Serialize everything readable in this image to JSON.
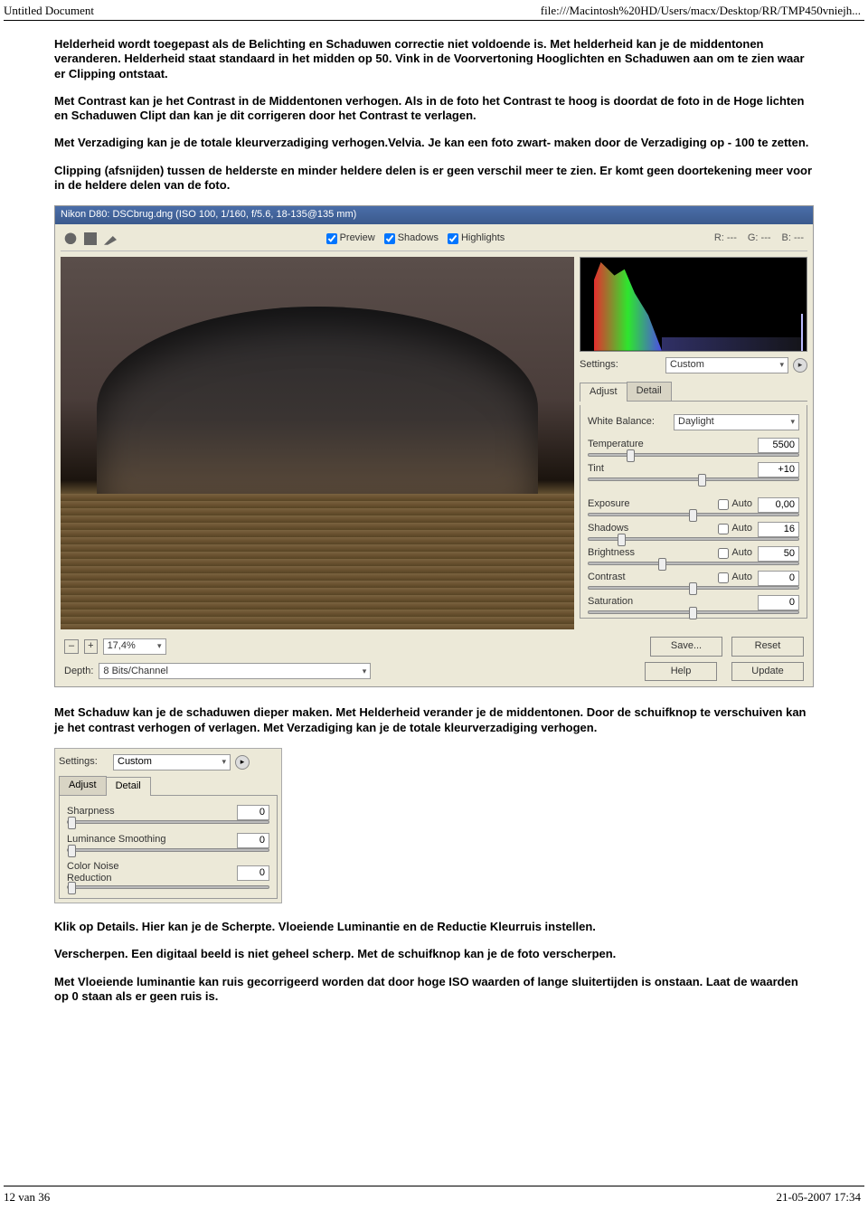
{
  "header": {
    "left": "Untitled Document",
    "right": "file:///Macintosh%20HD/Users/macx/Desktop/RR/TMP450vniejh..."
  },
  "paragraphs": {
    "p1": "Helderheid wordt toegepast als de Belichting en Schaduwen correctie niet voldoende is. Met helderheid kan je de middentonen veranderen. Helderheid staat standaard in het midden op 50. Vink in de Voorvertoning Hooglichten en Schaduwen aan om te zien waar er Clipping ontstaat.",
    "p2": "Met Contrast kan je het Contrast in de Middentonen verhogen. Als in de foto het Contrast te hoog is doordat de foto in de Hoge lichten en Schaduwen Clipt dan kan je dit corrigeren door het Contrast te verlagen.",
    "p3": "Met Verzadiging kan je de totale kleurverzadiging verhogen.Velvia. Je kan een foto zwart- maken door de Verzadiging op - 100 te zetten.",
    "p4": "Clipping (afsnijden) tussen de helderste en minder heldere delen is er geen verschil meer te zien. Er komt geen doortekening meer voor in de heldere delen van de foto.",
    "p5": "Met Schaduw kan je de schaduwen dieper maken. Met Helderheid verander je de middentonen. Door de schuifknop te verschuiven kan je het contrast verhogen of verlagen. Met Verzadiging kan je de totale kleurverzadiging verhogen.",
    "p6": "Klik op Details. Hier kan je de Scherpte. Vloeiende Luminantie en de Reductie Kleurruis instellen.",
    "p7": "Verscherpen. Een digitaal beeld is niet geheel scherp. Met de schuifknop kan je de foto verscherpen.",
    "p8": "Met Vloeiende luminantie kan ruis gecorrigeerd worden dat door hoge ISO waarden of lange sluitertijden is onstaan. Laat de waarden op 0 staan als er geen ruis is."
  },
  "acr": {
    "title": "Nikon D80: DSCbrug.dng (ISO 100, 1/160, f/5.6, 18-135@135 mm)",
    "checks": {
      "preview": "Preview",
      "shadows": "Shadows",
      "highlights": "Highlights"
    },
    "rgb": {
      "r": "R: ---",
      "g": "G: ---",
      "b": "B: ---"
    },
    "settings_label": "Settings:",
    "settings_value": "Custom",
    "tabs": {
      "adjust": "Adjust",
      "detail": "Detail"
    },
    "wb_label": "White Balance:",
    "wb_value": "Daylight",
    "sliders": {
      "temperature": {
        "label": "Temperature",
        "value": "5500"
      },
      "tint": {
        "label": "Tint",
        "value": "+10"
      },
      "exposure": {
        "label": "Exposure",
        "auto": "Auto",
        "value": "0,00"
      },
      "shadows": {
        "label": "Shadows",
        "auto": "Auto",
        "value": "16"
      },
      "brightness": {
        "label": "Brightness",
        "auto": "Auto",
        "value": "50"
      },
      "contrast": {
        "label": "Contrast",
        "auto": "Auto",
        "value": "0"
      },
      "saturation": {
        "label": "Saturation",
        "value": "0"
      }
    },
    "zoom": "17,4%",
    "buttons": {
      "save": "Save...",
      "reset": "Reset",
      "help": "Help",
      "update": "Update"
    },
    "depth_label": "Depth:",
    "depth_value": "8 Bits/Channel"
  },
  "detail": {
    "settings_label": "Settings:",
    "settings_value": "Custom",
    "tabs": {
      "adjust": "Adjust",
      "detail": "Detail"
    },
    "sliders": {
      "sharpness": {
        "label": "Sharpness",
        "value": "0"
      },
      "lum": {
        "label": "Luminance Smoothing",
        "value": "0"
      },
      "cnr": {
        "label": "Color Noise Reduction",
        "value": "0"
      }
    }
  },
  "footer": {
    "left": "12 van 36",
    "right": "21-05-2007 17:34"
  }
}
